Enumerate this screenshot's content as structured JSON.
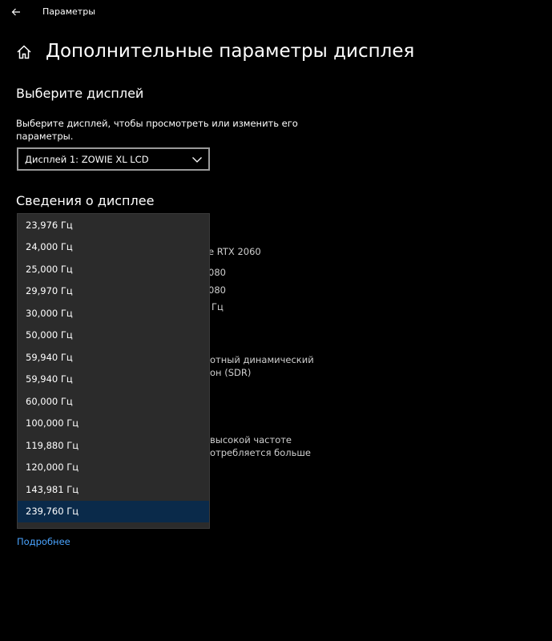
{
  "titlebar": {
    "title": "Параметры",
    "back_icon": "back-arrow-icon"
  },
  "header": {
    "title": "Дополнительные параметры дисплея",
    "icon": "home-icon"
  },
  "select_display": {
    "heading": "Выберите дисплей",
    "description": "Выберите дисплей, чтобы просмотреть или изменить его параметры.",
    "selected": "Дисплей 1: ZOWIE XL LCD"
  },
  "display_info": {
    "heading": "Сведения о дисплее",
    "partial_lines": [
      "e RTX 2060",
      "080",
      "080",
      "Гц",
      "отный динамический",
      "он (SDR)",
      "высокой частоте",
      "отребляется больше"
    ]
  },
  "refresh_dropdown": {
    "options": [
      "23,976 Гц",
      "24,000 Гц",
      "25,000 Гц",
      "29,970 Гц",
      "30,000 Гц",
      "50,000 Гц",
      "59,940 Гц",
      "59,940 Гц",
      "60,000 Гц",
      "100,000 Гц",
      "119,880 Гц",
      "120,000 Гц",
      "143,981 Гц",
      "239,760 Гц"
    ],
    "selected_index": 13
  },
  "more_link": "Подробнее",
  "colors": {
    "background": "#000000",
    "accent_link": "#4aa4ff",
    "dropdown_bg": "#2b2b2b",
    "selected_bg": "#0a2a4a"
  }
}
